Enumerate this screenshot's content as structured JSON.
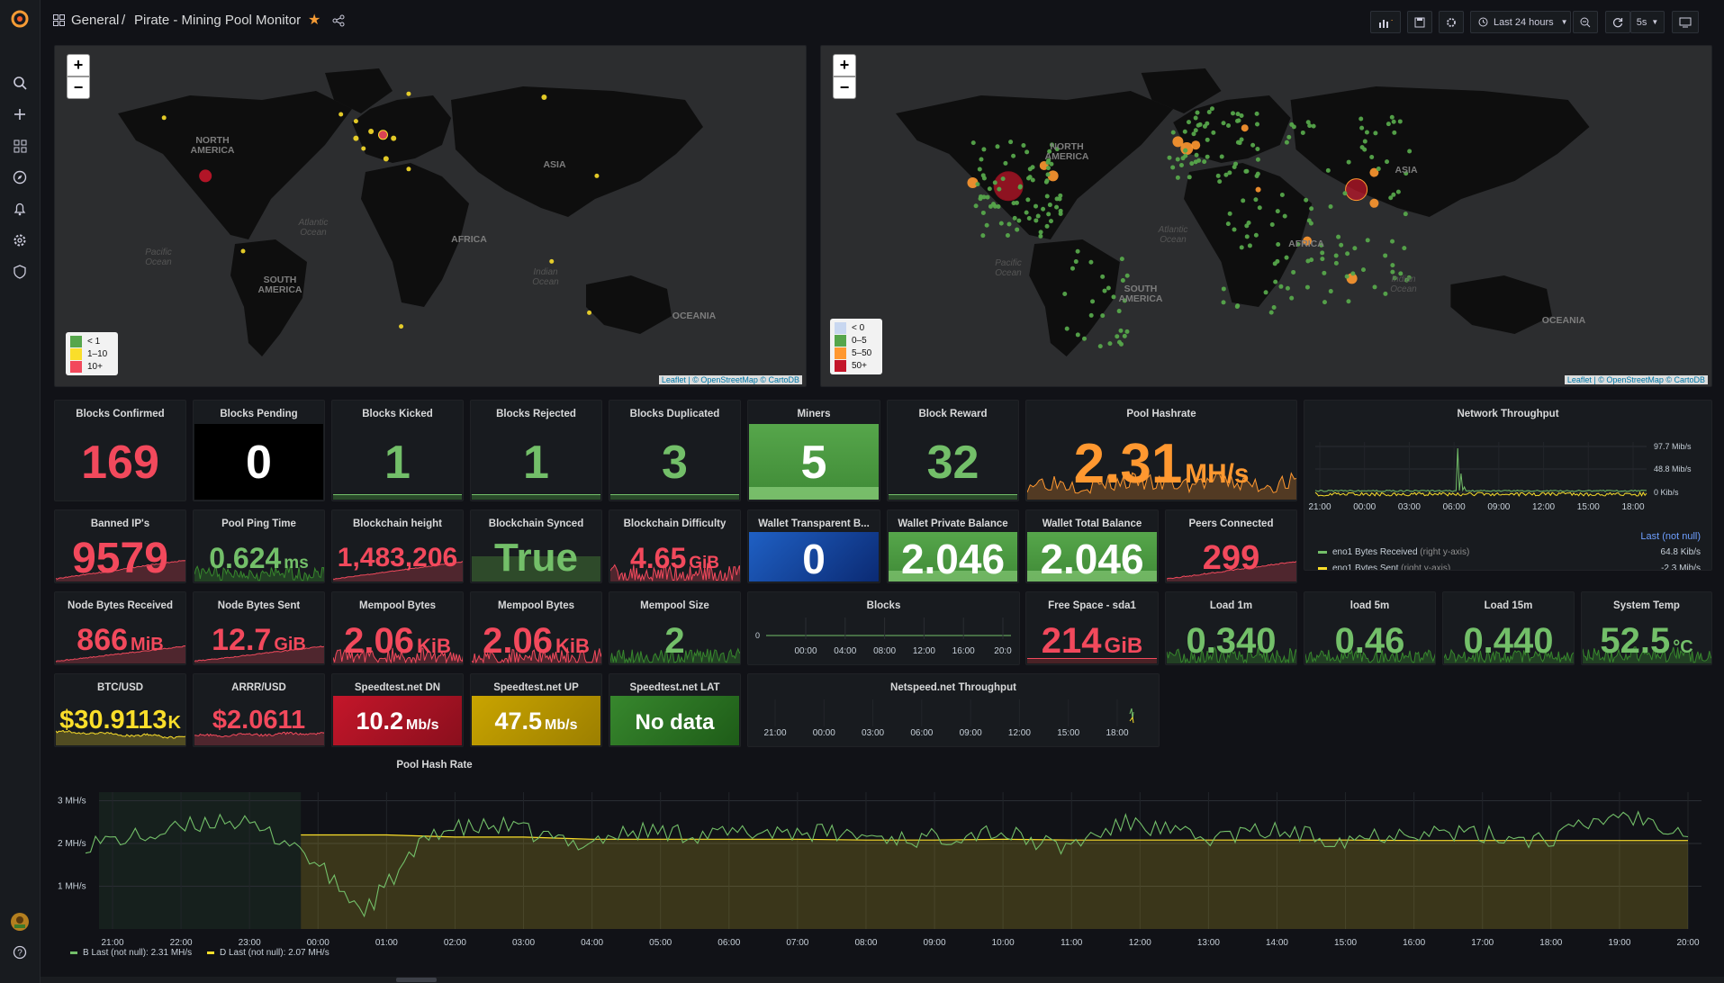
{
  "breadcrumb": {
    "folder": "General",
    "separator": "/",
    "dashboard": "Pirate - Mining Pool Monitor"
  },
  "toolbar": {
    "time_range": "Last 24 hours",
    "refresh": "5s"
  },
  "maps": {
    "left": {
      "legend": [
        "< 1",
        "1–10",
        "10+"
      ],
      "colors": [
        "#56a64b",
        "#fade2a",
        "#f2495c"
      ],
      "attribution": "Leaflet | © OpenStreetMap © CartoDB",
      "labels": [
        "NORTH AMERICA",
        "SOUTH AMERICA",
        "AFRICA",
        "ASIA",
        "OCEANIA"
      ],
      "oceans": [
        "Atlantic Ocean",
        "Pacific Ocean",
        "Indian Ocean"
      ]
    },
    "right": {
      "legend": [
        "< 0",
        "0–5",
        "5–50",
        "50+"
      ],
      "colors": [
        "#c8d7f0",
        "#56a64b",
        "#ff9830",
        "#c4162a"
      ],
      "attribution": "Leaflet | © OpenStreetMap © CartoDB",
      "labels": [
        "NORTH AMERICA",
        "SOUTH AMERICA",
        "AFRICA",
        "ASIA",
        "OCEANIA"
      ],
      "oceans": [
        "Atlantic Ocean",
        "Pacific Ocean",
        "Indian Ocean"
      ]
    },
    "zoom_in": "+",
    "zoom_out": "−"
  },
  "stats": {
    "blocks_confirmed": {
      "title": "Blocks Confirmed",
      "value": "169",
      "color": "#f2495c"
    },
    "blocks_pending": {
      "title": "Blocks Pending",
      "value": "0",
      "color": "#ffffff"
    },
    "blocks_kicked": {
      "title": "Blocks Kicked",
      "value": "1",
      "color": "#73bf69"
    },
    "blocks_rejected": {
      "title": "Blocks Rejected",
      "value": "1",
      "color": "#73bf69"
    },
    "blocks_duplicated": {
      "title": "Blocks Duplicated",
      "value": "3",
      "color": "#73bf69"
    },
    "miners": {
      "title": "Miners",
      "value": "5",
      "color": "#ffffff"
    },
    "block_reward": {
      "title": "Block Reward",
      "value": "32",
      "color": "#73bf69"
    },
    "pool_hashrate": {
      "title": "Pool Hashrate",
      "value": "2.31",
      "unit": "MH/s",
      "color": "#ff9830"
    },
    "banned_ips": {
      "title": "Banned IP's",
      "value": "9579",
      "color": "#f2495c"
    },
    "pool_ping": {
      "title": "Pool Ping Time",
      "value": "0.624",
      "unit": "ms",
      "color": "#73bf69"
    },
    "chain_height": {
      "title": "Blockchain height",
      "value": "1,483,206",
      "color": "#f2495c"
    },
    "chain_synced": {
      "title": "Blockchain Synced",
      "value": "True",
      "color": "#73bf69"
    },
    "chain_difficulty": {
      "title": "Blockchain Difficulty",
      "value": "4.65",
      "unit": "GiB",
      "color": "#f2495c"
    },
    "wallet_transparent": {
      "title": "Wallet Transparent B...",
      "value": "0",
      "color": "#ffffff"
    },
    "wallet_private": {
      "title": "Wallet Private Balance",
      "value": "2.046",
      "color": "#ffffff"
    },
    "wallet_total": {
      "title": "Wallet Total Balance",
      "value": "2.046",
      "color": "#ffffff"
    },
    "peers": {
      "title": "Peers Connected",
      "value": "299",
      "color": "#f2495c"
    },
    "node_rx": {
      "title": "Node Bytes Received",
      "value": "866",
      "unit": "MiB",
      "color": "#f2495c"
    },
    "node_tx": {
      "title": "Node Bytes Sent",
      "value": "12.7",
      "unit": "GiB",
      "color": "#f2495c"
    },
    "mempool_bytes_1": {
      "title": "Mempool Bytes",
      "value": "2.06",
      "unit": "KiB",
      "color": "#f2495c"
    },
    "mempool_bytes_2": {
      "title": "Mempool Bytes",
      "value": "2.06",
      "unit": "KiB",
      "color": "#f2495c"
    },
    "mempool_size": {
      "title": "Mempool Size",
      "value": "2",
      "color": "#73bf69"
    },
    "free_space": {
      "title": "Free Space - sda1",
      "value": "214",
      "unit": "GiB",
      "color": "#f2495c"
    },
    "load1": {
      "title": "Load 1m",
      "value": "0.340",
      "color": "#73bf69"
    },
    "load5": {
      "title": "load 5m",
      "value": "0.46",
      "color": "#73bf69"
    },
    "load15": {
      "title": "Load 15m",
      "value": "0.440",
      "color": "#73bf69"
    },
    "system_temp": {
      "title": "System Temp",
      "value": "52.5",
      "unit": "°C",
      "color": "#73bf69"
    },
    "btc_usd": {
      "title": "BTC/USD",
      "value": "$30.9113",
      "unit": "K",
      "color": "#fade2a"
    },
    "arrr_usd": {
      "title": "ARRR/USD",
      "value": "$2.0611",
      "color": "#f2495c"
    },
    "speed_dn": {
      "title": "Speedtest.net DN",
      "value": "10.2",
      "unit": "Mb/s",
      "color": "#ffffff"
    },
    "speed_up": {
      "title": "Speedtest.net UP",
      "value": "47.5",
      "unit": "Mb/s",
      "color": "#ffffff"
    },
    "speed_lat": {
      "title": "Speedtest.net LAT",
      "value": "No data",
      "color": "#ffffff"
    }
  },
  "network": {
    "title": "Network Throughput",
    "y_ticks": [
      "97.7 Mib/s",
      "48.8 Mib/s",
      "0 Kib/s"
    ],
    "x_ticks": [
      "21:00",
      "00:00",
      "03:00",
      "06:00",
      "09:00",
      "12:00",
      "15:00",
      "18:00"
    ],
    "legend_header": "Last (not null)",
    "series": [
      {
        "name": "eno1 Bytes Received",
        "suffix": "(right y-axis)",
        "last": "64.8 Kib/s",
        "color": "#73bf69"
      },
      {
        "name": "eno1 Bytes Sent",
        "suffix": "(right y-axis)",
        "last": "-2.3 Mib/s",
        "color": "#fade2a"
      }
    ]
  },
  "blocks_panel": {
    "title": "Blocks",
    "y_tick": "0",
    "x_ticks": [
      "00:00",
      "04:00",
      "08:00",
      "12:00",
      "16:00",
      "20:0"
    ]
  },
  "netspeed_panel": {
    "title": "Netspeed.net Throughput",
    "x_ticks": [
      "21:00",
      "00:00",
      "03:00",
      "06:00",
      "09:00",
      "12:00",
      "15:00",
      "18:00"
    ]
  },
  "hashrate": {
    "title": "Pool Hash Rate",
    "y_ticks": [
      "3 MH/s",
      "2 MH/s",
      "1 MH/s"
    ],
    "x_ticks": [
      "21:00",
      "22:00",
      "23:00",
      "00:00",
      "01:00",
      "02:00",
      "03:00",
      "04:00",
      "05:00",
      "06:00",
      "07:00",
      "08:00",
      "09:00",
      "10:00",
      "11:00",
      "12:00",
      "13:00",
      "14:00",
      "15:00",
      "16:00",
      "17:00",
      "18:00",
      "19:00",
      "20:00"
    ],
    "legend": [
      {
        "label": "B  Last (not null): 2.31 MH/s",
        "color": "#73bf69"
      },
      {
        "label": "D  Last (not null): 2.07 MH/s",
        "color": "#fade2a"
      }
    ]
  },
  "chart_data": [
    {
      "type": "line",
      "title": "Pool Hash Rate",
      "ylabel": "MH/s",
      "ylim": [
        0,
        3.2
      ],
      "x": [
        "21:00",
        "22:00",
        "23:00",
        "00:00",
        "01:00",
        "02:00",
        "03:00",
        "04:00",
        "05:00",
        "06:00",
        "07:00",
        "08:00",
        "09:00",
        "10:00",
        "11:00",
        "12:00",
        "13:00",
        "14:00",
        "15:00",
        "16:00",
        "17:00",
        "18:00",
        "19:00",
        "20:00"
      ],
      "series": [
        {
          "name": "B",
          "values": [
            2.0,
            2.2,
            2.6,
            2.0,
            0.4,
            2.3,
            2.4,
            2.0,
            2.3,
            2.2,
            2.3,
            2.2,
            2.1,
            2.3,
            1.9,
            2.5,
            2.1,
            2.3,
            2.1,
            2.3,
            2.2,
            2.1,
            2.7,
            2.31
          ]
        },
        {
          "name": "D",
          "values": [
            null,
            null,
            null,
            2.2,
            2.2,
            2.15,
            2.15,
            2.1,
            2.1,
            2.1,
            2.1,
            2.08,
            2.08,
            2.1,
            2.08,
            2.08,
            2.08,
            2.08,
            2.08,
            2.07,
            2.07,
            2.07,
            2.07,
            2.07
          ]
        }
      ]
    },
    {
      "type": "line",
      "title": "Network Throughput",
      "x": [
        "21:00",
        "00:00",
        "03:00",
        "06:00",
        "09:00",
        "12:00",
        "15:00",
        "18:00"
      ],
      "series": [
        {
          "name": "eno1 Bytes Received",
          "values": [
            0.1,
            0.1,
            0.1,
            0.1,
            80,
            0.1,
            0.1,
            0.1
          ]
        },
        {
          "name": "eno1 Bytes Sent",
          "values": [
            -2.3,
            -2.3,
            -2.3,
            -2.3,
            -2.3,
            -2.3,
            -2.3,
            -2.3
          ]
        }
      ]
    }
  ]
}
